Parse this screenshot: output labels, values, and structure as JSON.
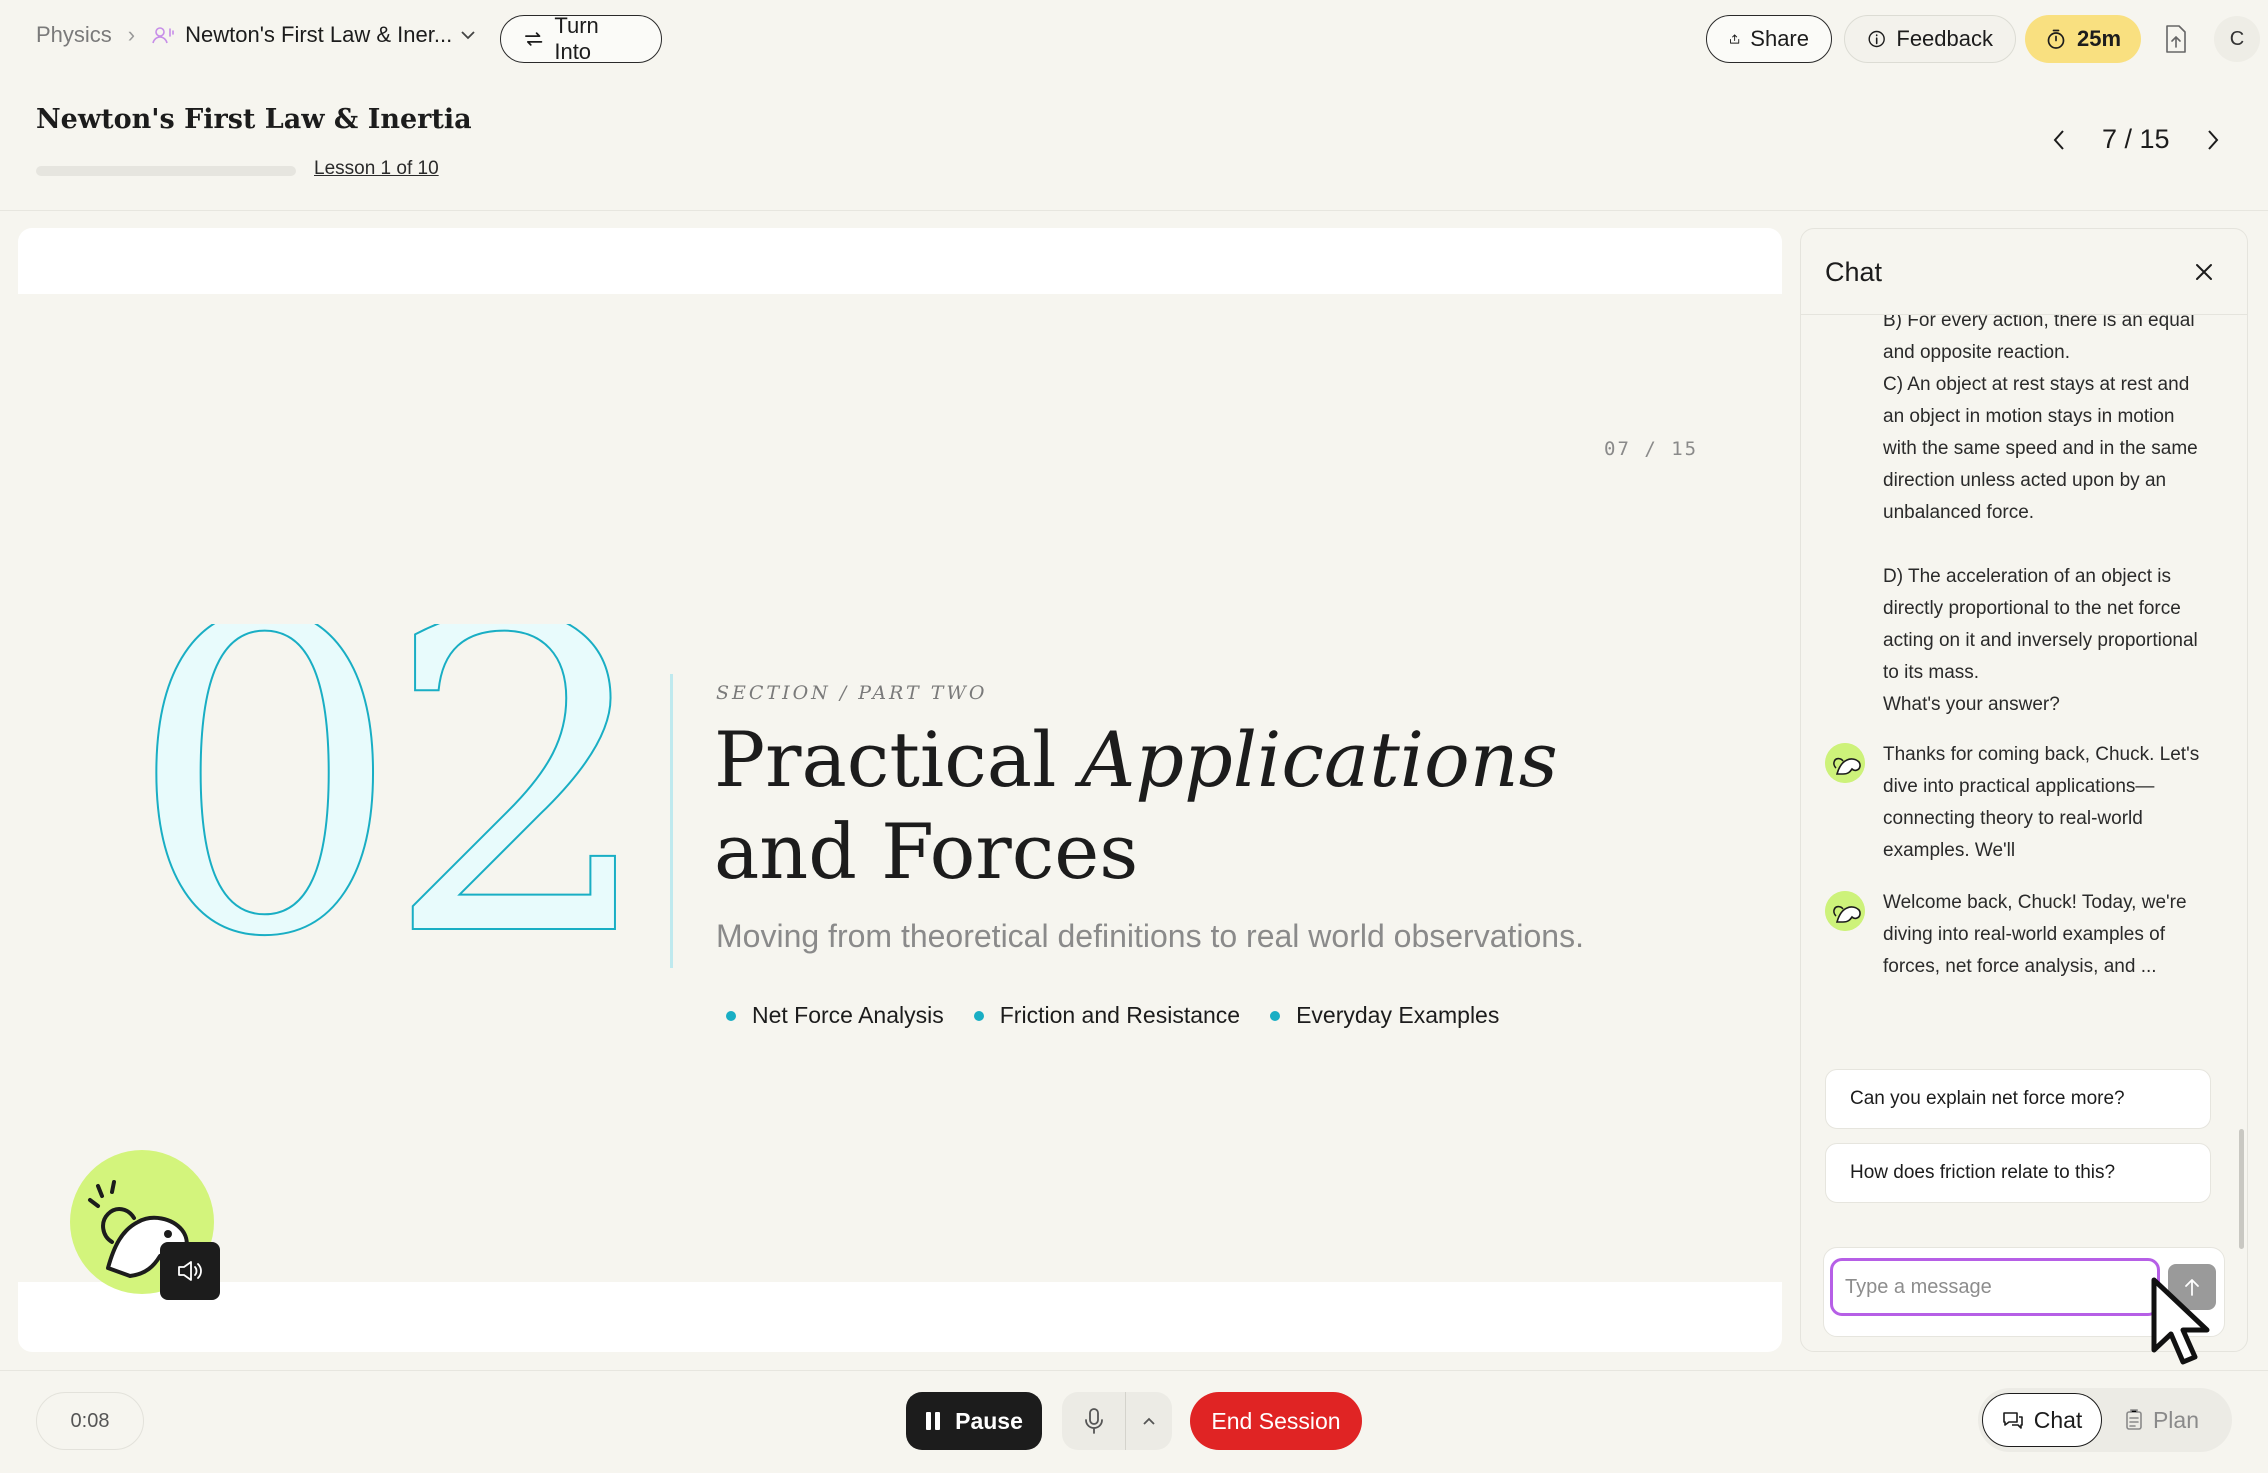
{
  "breadcrumb": {
    "root": "Physics",
    "current": "Newton's First Law & Iner..."
  },
  "header": {
    "turn_into": "Turn Into",
    "share": "Share",
    "feedback": "Feedback",
    "timer": "25m",
    "avatar_initial": "C"
  },
  "lesson": {
    "title": "Newton's First Law & Inertia",
    "progress_fraction": 0.0,
    "lesson_link": "Lesson 1 of 10",
    "pager": "7 / 15"
  },
  "slide": {
    "counter": "07 / 15",
    "big_number": "02",
    "section_label": "SECTION / PART TWO",
    "headline_plain": "Practical ",
    "headline_italic": "Applications",
    "headline_line2": "and Forces",
    "subhead": "Moving from theoretical definitions to real world observations.",
    "topics": [
      "Net Force Analysis",
      "Friction and Resistance",
      "Everyday Examples"
    ],
    "accent_color": "#19aec4"
  },
  "chat": {
    "title": "Chat",
    "options": [
      "B) For every action, there is an equal and opposite reaction.",
      "C) An object at rest stays at rest and an object in motion stays in motion with the same speed and in the same direction unless acted upon by an unbalanced force.",
      "D) The acceleration of an object is directly proportional to the net force acting on it and inversely proportional to its mass.",
      "What's your answer?"
    ],
    "messages": [
      "Thanks for coming back, Chuck. Let's dive into practical applications—connecting theory to real-world examples. We'll",
      "Welcome back, Chuck! Today, we're diving into real-world examples of forces, net force analysis, and ..."
    ],
    "suggestions": [
      "Can you explain net force more?",
      "How does friction relate to this?"
    ],
    "input_placeholder": "Type a message",
    "input_value": ""
  },
  "footer": {
    "elapsed": "0:08",
    "pause": "Pause",
    "end_session": "End Session",
    "view_chat": "Chat",
    "view_plan": "Plan"
  }
}
